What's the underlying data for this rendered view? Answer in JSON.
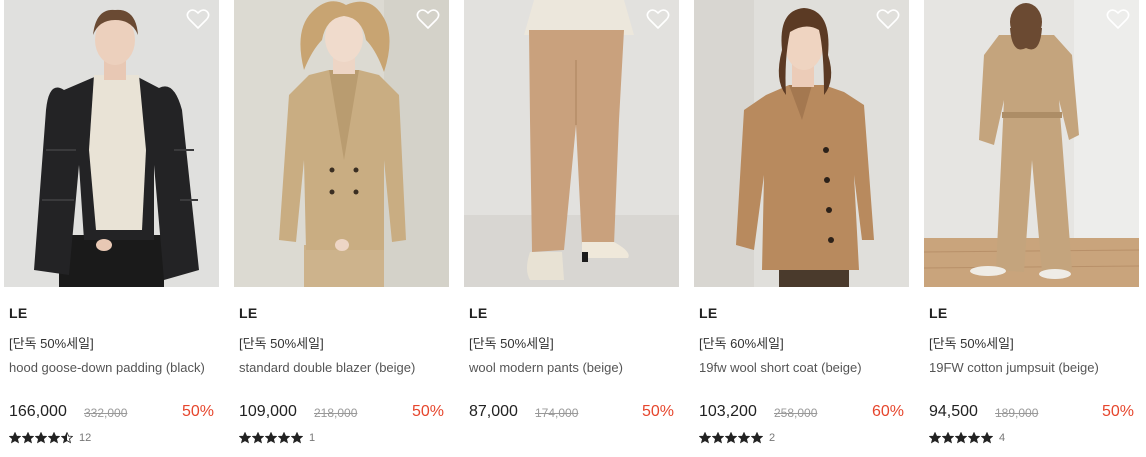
{
  "products": [
    {
      "brand": "LE",
      "promo": "[단독 50%세일]",
      "name": "hood goose-down padding (black)",
      "price": "166,000",
      "original": "332,000",
      "discount": "50%",
      "rating": 4.5,
      "reviews": "12",
      "photo": "model-black-down-padding"
    },
    {
      "brand": "LE",
      "promo": "[단독 50%세일]",
      "name": "standard double blazer (beige)",
      "price": "109,000",
      "original": "218,000",
      "discount": "50%",
      "rating": 5,
      "reviews": "1",
      "photo": "model-beige-double-blazer"
    },
    {
      "brand": "LE",
      "promo": "[단독 50%세일]",
      "name": "wool modern pants (beige)",
      "price": "87,000",
      "original": "174,000",
      "discount": "50%",
      "rating": 0,
      "reviews": "",
      "photo": "model-beige-wool-pants"
    },
    {
      "brand": "LE",
      "promo": "[단독 60%세일]",
      "name": "19fw wool short coat (beige)",
      "price": "103,200",
      "original": "258,000",
      "discount": "60%",
      "rating": 5,
      "reviews": "2",
      "photo": "model-camel-short-coat"
    },
    {
      "brand": "LE",
      "promo": "[단독 50%세일]",
      "name": "19FW cotton jumpsuit (beige)",
      "price": "94,500",
      "original": "189,000",
      "discount": "50%",
      "rating": 5,
      "reviews": "4",
      "photo": "model-beige-cotton-jumpsuit"
    }
  ],
  "icons": {
    "wishlist": "heart-outline-icon",
    "star": "star-icon"
  },
  "colors": {
    "discount": "#e6462d",
    "star": "#222222",
    "price": "#222222",
    "strike": "#999999"
  }
}
